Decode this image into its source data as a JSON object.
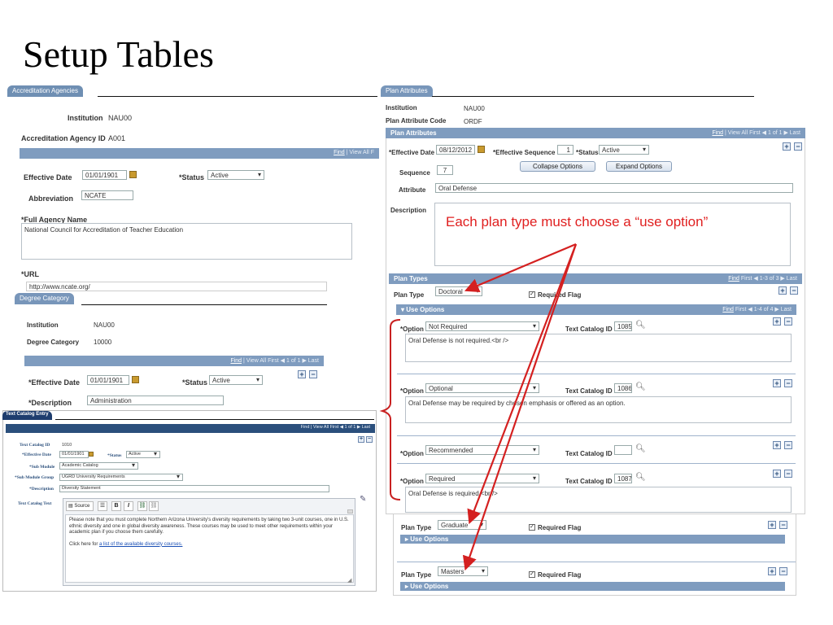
{
  "slide": {
    "title": "Setup Tables"
  },
  "accred": {
    "tab": "Accreditation Agencies",
    "institution_label": "Institution",
    "institution_value": "NAU00",
    "agency_id_label": "Accreditation Agency ID",
    "agency_id_value": "A001",
    "bar_find": "Find",
    "bar_rest": " | View All  F",
    "eff_date_label": "Effective Date",
    "eff_date_value": "01/01/1901",
    "status_label": "*Status",
    "status_value": "Active",
    "abbrev_label": "Abbreviation",
    "abbrev_value": "NCATE",
    "full_name_label": "*Full Agency Name",
    "full_name_value": "National Council for Accreditation of Teacher Education",
    "url_label": "*URL",
    "url_value": "http://www.ncate.org/"
  },
  "degree": {
    "tab": "Degree Category",
    "institution_label": "Institution",
    "institution_value": "NAU00",
    "category_label": "Degree Category",
    "category_value": "10000",
    "bar_find": "Find",
    "bar_rest": " | View All   First ◀ 1 of 1 ▶ Last",
    "eff_date_label": "*Effective Date",
    "eff_date_value": "01/01/1901",
    "status_label": "*Status",
    "status_value": "Active",
    "desc_label": "*Description",
    "desc_value": "Administration"
  },
  "textcat": {
    "tab": "Text Catalog Entry",
    "bar_text": "Find | View All     First ◀ 1 of 1 ▶ Last",
    "id_label": "Text Catalog ID",
    "id_value": "1010",
    "eff_label": "*Effective Date",
    "eff_value": "01/01/1901",
    "status_label": "*Status",
    "status_value": "Active",
    "submodule_label": "*Sub Module",
    "submodule_value": "Academic Catalog",
    "submodgroup_label": "*Sub Module Group",
    "submodgroup_value": "UGRD University Requirements",
    "desc_label": "*Description",
    "desc_value": "Diversity Statement",
    "text_label": "Text Catalog Text",
    "toolbar_source": "Source",
    "toolbar_bold": "B",
    "toolbar_italic": "I",
    "body_p1": "Please note that you must complete Northern Arizona University's diversity requirements by taking two 3-unit courses, one in U.S. ethnic diversity and one in global diversity awareness. These courses may be used to meet other requirements within your academic plan if you choose them carefully.",
    "body_p2_prefix": "Click here for ",
    "body_p2_link": "a list of the available diversity courses."
  },
  "plan": {
    "tab": "Plan Attributes",
    "institution_label": "Institution",
    "institution_value": "NAU00",
    "code_label": "Plan Attribute Code",
    "code_value": "ORDF",
    "bar_title": "Plan Attributes",
    "bar_find": "Find",
    "bar_rest": " | View All   First ◀ 1 of 1 ▶ Last",
    "eff_label": "*Effective Date",
    "eff_value": "08/12/2012",
    "seq_eff_label": "*Effective Sequence",
    "seq_eff_value": "1",
    "status_label": "*Status",
    "status_value": "Active",
    "sequence_label": "Sequence",
    "sequence_value": "7",
    "collapse_btn": "Collapse Options",
    "expand_btn": "Expand Options",
    "attribute_label": "Attribute",
    "attribute_value": "Oral Defense",
    "description_label": "Description",
    "plan_types_bar": "Plan Types",
    "plan_types_find": "Find",
    "plan_types_rest": "  First ◀ 1-3 of 3 ▶ Last",
    "plan_type_label": "Plan Type",
    "required_flag_label": "Required Flag",
    "use_options_bar": "Use Options",
    "use_options_find": "Find",
    "use_options_rest": "  First ◀ 1-4 of 4 ▶ Last",
    "option_label": "*Option",
    "text_cat_label": "Text Catalog ID",
    "plan_types": [
      {
        "value": "Doctoral"
      },
      {
        "value": "Graduate"
      },
      {
        "value": "Masters"
      }
    ],
    "options": [
      {
        "value": "Not Required",
        "text_id": "1085",
        "desc": "Oral Defense is not required.<br />"
      },
      {
        "value": "Optional",
        "text_id": "1086",
        "desc": "Oral Defense may be required by chosen emphasis or offered as an option."
      },
      {
        "value": "Recommended",
        "text_id": "",
        "desc": ""
      },
      {
        "value": "Required",
        "text_id": "1087",
        "desc": "Oral Defense is required.<br />"
      }
    ]
  },
  "annotation": {
    "text": "Each plan type must choose a “use option”",
    "color": "#e02020"
  }
}
